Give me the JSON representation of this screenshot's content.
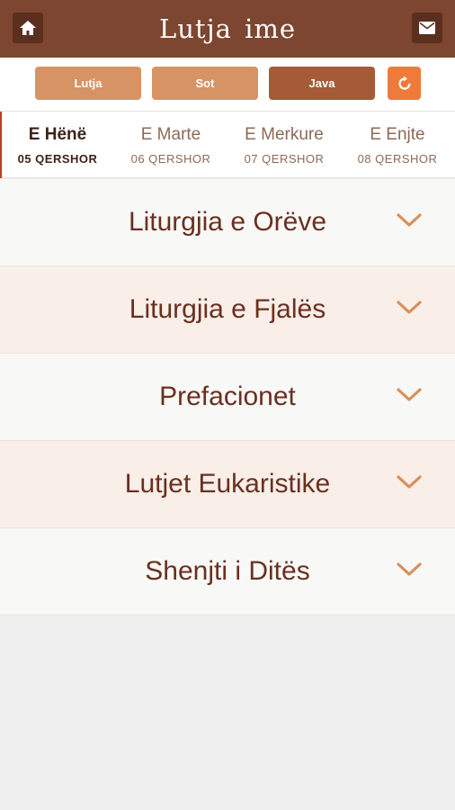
{
  "header": {
    "title": "Lutja  ime",
    "home_icon": "home-icon",
    "mail_icon": "mail-icon",
    "background": "#7d4630"
  },
  "toolbar": {
    "buttons": [
      {
        "label": "Lutja"
      },
      {
        "label": "Sot"
      },
      {
        "label": "Java"
      }
    ],
    "refresh_icon": "refresh-icon",
    "accent": "#ef7a3a"
  },
  "days": [
    {
      "name": "E Hënë",
      "date": "05 QERSHOR",
      "active": true
    },
    {
      "name": "E Marte",
      "date": "06 QERSHOR",
      "active": false
    },
    {
      "name": "E Merkure",
      "date": "07 QERSHOR",
      "active": false
    },
    {
      "name": "E Enjte",
      "date": "08 QERSHOR",
      "active": false
    }
  ],
  "sections": [
    {
      "title": "Liturgjia e Orëve"
    },
    {
      "title": "Liturgjia e Fjalës"
    },
    {
      "title": "Prefacionet"
    },
    {
      "title": "Lutjet Eukaristike"
    },
    {
      "title": "Shenjti i Ditës"
    }
  ]
}
